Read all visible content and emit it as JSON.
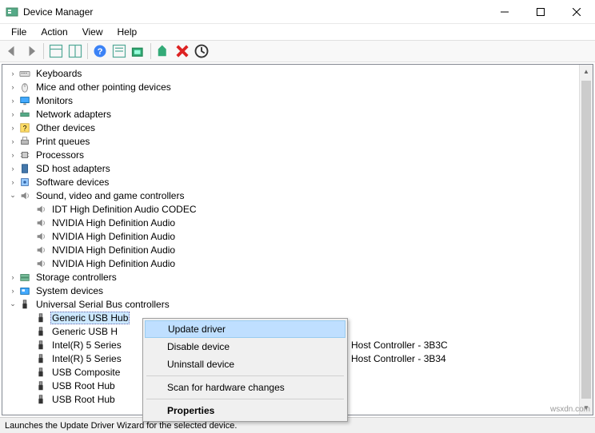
{
  "window": {
    "title": "Device Manager"
  },
  "menubar": [
    "File",
    "Action",
    "View",
    "Help"
  ],
  "tree": [
    {
      "level": 1,
      "exp": "closed",
      "icon": "keyboard",
      "label": "Keyboards"
    },
    {
      "level": 1,
      "exp": "closed",
      "icon": "mouse",
      "label": "Mice and other pointing devices"
    },
    {
      "level": 1,
      "exp": "closed",
      "icon": "monitor",
      "label": "Monitors"
    },
    {
      "level": 1,
      "exp": "closed",
      "icon": "network",
      "label": "Network adapters"
    },
    {
      "level": 1,
      "exp": "closed",
      "icon": "other",
      "label": "Other devices"
    },
    {
      "level": 1,
      "exp": "closed",
      "icon": "printer",
      "label": "Print queues"
    },
    {
      "level": 1,
      "exp": "closed",
      "icon": "processor",
      "label": "Processors"
    },
    {
      "level": 1,
      "exp": "closed",
      "icon": "sd",
      "label": "SD host adapters"
    },
    {
      "level": 1,
      "exp": "closed",
      "icon": "software",
      "label": "Software devices"
    },
    {
      "level": 1,
      "exp": "open",
      "icon": "sound",
      "label": "Sound, video and game controllers"
    },
    {
      "level": 2,
      "exp": "none",
      "icon": "sound",
      "label": "IDT High Definition Audio CODEC"
    },
    {
      "level": 2,
      "exp": "none",
      "icon": "sound",
      "label": "NVIDIA High Definition Audio"
    },
    {
      "level": 2,
      "exp": "none",
      "icon": "sound",
      "label": "NVIDIA High Definition Audio"
    },
    {
      "level": 2,
      "exp": "none",
      "icon": "sound",
      "label": "NVIDIA High Definition Audio"
    },
    {
      "level": 2,
      "exp": "none",
      "icon": "sound",
      "label": "NVIDIA High Definition Audio"
    },
    {
      "level": 1,
      "exp": "closed",
      "icon": "storage",
      "label": "Storage controllers"
    },
    {
      "level": 1,
      "exp": "closed",
      "icon": "system",
      "label": "System devices"
    },
    {
      "level": 1,
      "exp": "open",
      "icon": "usb",
      "label": "Universal Serial Bus controllers"
    },
    {
      "level": 2,
      "exp": "none",
      "icon": "usb",
      "label": "Generic USB Hub",
      "selected": true
    },
    {
      "level": 2,
      "exp": "none",
      "icon": "usb",
      "label": "Generic USB Hub",
      "truncated": "Generic USB H"
    },
    {
      "level": 2,
      "exp": "none",
      "icon": "usb",
      "label": "Intel(R) 5 Series",
      "suffix": "Host Controller - 3B3C"
    },
    {
      "level": 2,
      "exp": "none",
      "icon": "usb",
      "label": "Intel(R) 5 Series",
      "suffix": "Host Controller - 3B34"
    },
    {
      "level": 2,
      "exp": "none",
      "icon": "usb",
      "label": "USB Composite"
    },
    {
      "level": 2,
      "exp": "none",
      "icon": "usb",
      "label": "USB Root Hub"
    },
    {
      "level": 2,
      "exp": "none",
      "icon": "usb",
      "label": "USB Root Hub"
    }
  ],
  "context_menu": {
    "items": [
      {
        "label": "Update driver",
        "hover": true
      },
      {
        "label": "Disable device"
      },
      {
        "label": "Uninstall device"
      },
      {
        "sep": true
      },
      {
        "label": "Scan for hardware changes"
      },
      {
        "sep": true
      },
      {
        "label": "Properties",
        "bold": true
      }
    ]
  },
  "statusbar": "Launches the Update Driver Wizard for the selected device.",
  "watermark": "wsxdn.com"
}
